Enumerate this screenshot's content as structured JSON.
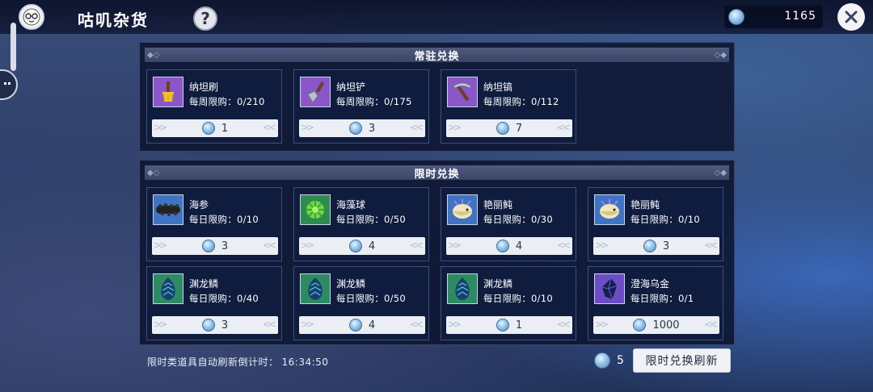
{
  "header": {
    "title": "咕叽杂货",
    "help_label": "?",
    "currency_value": "1165"
  },
  "permanent": {
    "title": "常驻兑换",
    "items": [
      {
        "name": "纳坦刷",
        "limit": "每周限购：0/210",
        "price": "1",
        "icon": "brush-icon"
      },
      {
        "name": "纳坦铲",
        "limit": "每周限购：0/175",
        "price": "3",
        "icon": "shovel-icon"
      },
      {
        "name": "纳坦镐",
        "limit": "每周限购：0/112",
        "price": "7",
        "icon": "pickaxe-icon"
      }
    ]
  },
  "limited": {
    "title": "限时兑换",
    "items": [
      {
        "name": "海参",
        "limit": "每日限购：0/10",
        "price": "3",
        "icon": "sea-cucumber-icon"
      },
      {
        "name": "海藻球",
        "limit": "每日限购：0/50",
        "price": "4",
        "icon": "seaweed-ball-icon"
      },
      {
        "name": "艳丽鲀",
        "limit": "每日限购：0/30",
        "price": "4",
        "icon": "pufferfish-icon"
      },
      {
        "name": "艳丽鲀",
        "limit": "每日限购：0/10",
        "price": "3",
        "icon": "pufferfish-icon"
      },
      {
        "name": "渊龙鳞",
        "limit": "每日限购：0/40",
        "price": "3",
        "icon": "dragon-scale-icon"
      },
      {
        "name": "渊龙鳞",
        "limit": "每日限购：0/50",
        "price": "4",
        "icon": "dragon-scale-icon"
      },
      {
        "name": "渊龙鳞",
        "limit": "每日限购：0/10",
        "price": "1",
        "icon": "dragon-scale-icon"
      },
      {
        "name": "澄海乌金",
        "limit": "每日限购：0/1",
        "price": "1000",
        "icon": "dark-gold-icon"
      }
    ]
  },
  "footer": {
    "countdown_label": "限时类道具自动刷新倒计时：",
    "countdown_value": "16:34:50",
    "refresh_cost": "5",
    "refresh_button": "限时兑换刷新"
  },
  "colors": {
    "accent_coin": "#9cc8ea",
    "card_bg": "#101c3e",
    "button_bg": "#ebeef3"
  }
}
